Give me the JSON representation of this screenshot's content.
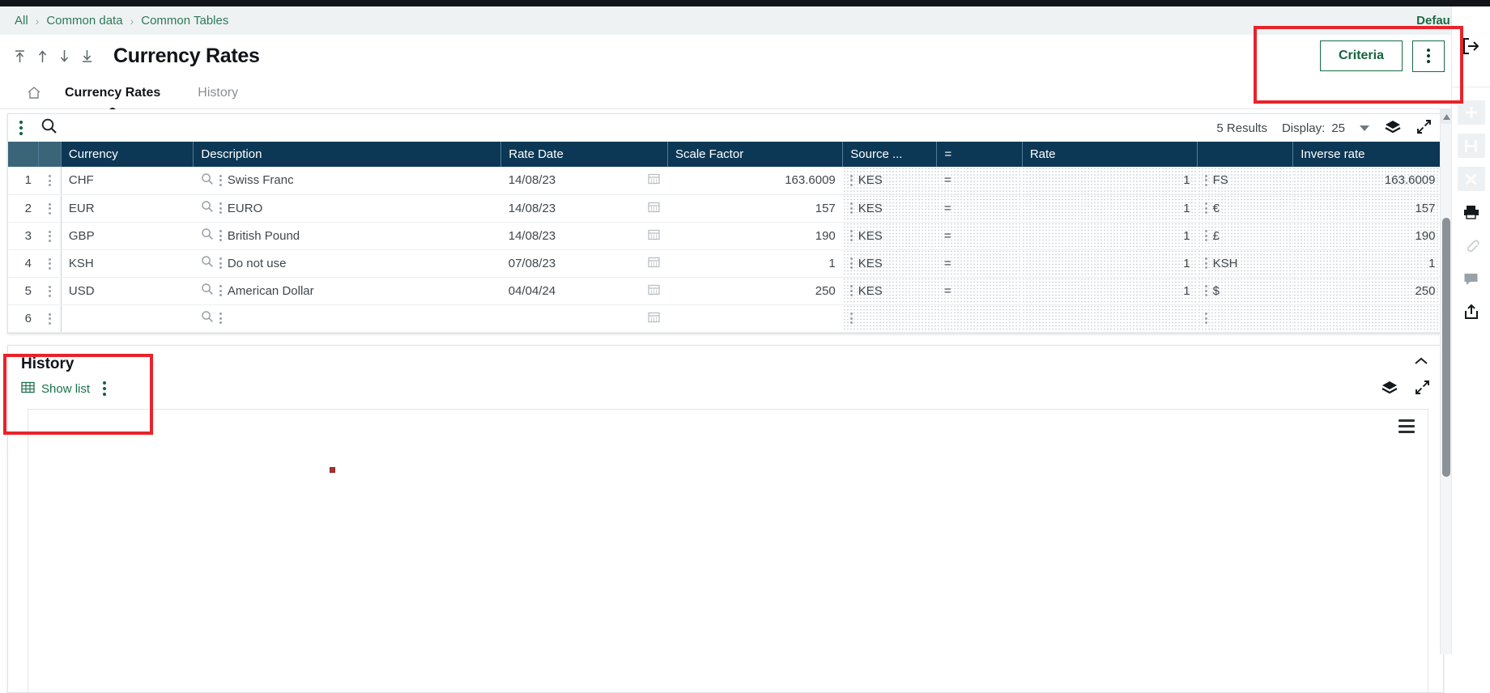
{
  "breadcrumb": {
    "items": [
      {
        "label": "All"
      },
      {
        "label": "Common data"
      },
      {
        "label": "Common Tables"
      }
    ],
    "separator": "›",
    "workspace": "Default"
  },
  "header": {
    "title": "Currency Rates",
    "nav": {
      "first_label": "first-record",
      "prev_label": "previous-record",
      "next_label": "next-record",
      "last_label": "last-record"
    },
    "criteria_label": "Criteria",
    "kebab_label": "More options"
  },
  "tabs": {
    "home_icon": "home-icon",
    "items": [
      {
        "label": "Currency Rates",
        "active": true
      },
      {
        "label": "History",
        "active": false
      }
    ]
  },
  "grid_toolbar": {
    "kebab_label": "Grid options",
    "search_icon": "search-icon",
    "results_text": "5 Results",
    "display_label": "Display:",
    "display_value": "25",
    "dropdown_icon": "chevron-down-icon",
    "layers_icon": "layers-icon",
    "expand_icon": "expand-icon"
  },
  "table": {
    "columns": [
      "Currency",
      "Description",
      "Rate Date",
      "Scale Factor",
      "Source ...",
      "=",
      "Rate",
      "Inverse rate"
    ],
    "rows": [
      {
        "num": "1",
        "currency": "CHF",
        "description": "Swiss Franc",
        "rate_date": "14/08/23",
        "scale_factor": "163.6009",
        "source": "KES",
        "eq": "=",
        "rate": "1",
        "symbol": "FS",
        "inverse_rate": "163.6009"
      },
      {
        "num": "2",
        "currency": "EUR",
        "description": "EURO",
        "rate_date": "14/08/23",
        "scale_factor": "157",
        "source": "KES",
        "eq": "=",
        "rate": "1",
        "symbol": "€",
        "inverse_rate": "157"
      },
      {
        "num": "3",
        "currency": "GBP",
        "description": "British Pound",
        "rate_date": "14/08/23",
        "scale_factor": "190",
        "source": "KES",
        "eq": "=",
        "rate": "1",
        "symbol": "£",
        "inverse_rate": "190"
      },
      {
        "num": "4",
        "currency": "KSH",
        "description": "Do not use",
        "rate_date": "07/08/23",
        "scale_factor": "1",
        "source": "KES",
        "eq": "=",
        "rate": "1",
        "symbol": "KSH",
        "inverse_rate": "1"
      },
      {
        "num": "5",
        "currency": "USD",
        "description": "American Dollar",
        "rate_date": "04/04/24",
        "scale_factor": "250",
        "source": "KES",
        "eq": "=",
        "rate": "1",
        "symbol": "$",
        "inverse_rate": "250"
      },
      {
        "num": "6",
        "currency": "",
        "description": "",
        "rate_date": "",
        "scale_factor": "",
        "source": "",
        "eq": "",
        "rate": "",
        "symbol": "",
        "inverse_rate": ""
      }
    ]
  },
  "history": {
    "title": "History",
    "show_list_label": "Show list",
    "table_icon": "table-icon",
    "kebab_label": "History options",
    "collapse_icon": "chevron-up-icon",
    "layers_icon": "layers-icon",
    "expand_icon": "expand-icon",
    "chart_menu_icon": "hamburger-menu-icon"
  },
  "chart_data": {
    "type": "scatter",
    "title": "",
    "xlabel": "",
    "ylabel": "",
    "points": [
      {
        "x": 0.215,
        "y": 0.205
      }
    ],
    "marker_color": "#a8312f",
    "grid": false,
    "legend": "none"
  },
  "right_rail": {
    "items": [
      {
        "name": "logout-icon"
      },
      {
        "name": "add-icon",
        "disabled": true
      },
      {
        "name": "save-icon",
        "disabled": true
      },
      {
        "name": "close-icon",
        "disabled": true
      },
      {
        "name": "print-icon",
        "disabled": false
      },
      {
        "name": "attachment-icon",
        "disabled": true
      },
      {
        "name": "comment-icon",
        "disabled": false
      },
      {
        "name": "share-icon",
        "disabled": false
      }
    ]
  },
  "annotations": {
    "accent_red": "#e8232a",
    "accent_green": "#16643f",
    "header_navy": "#0d3855",
    "header_teal": "#3a6478"
  }
}
